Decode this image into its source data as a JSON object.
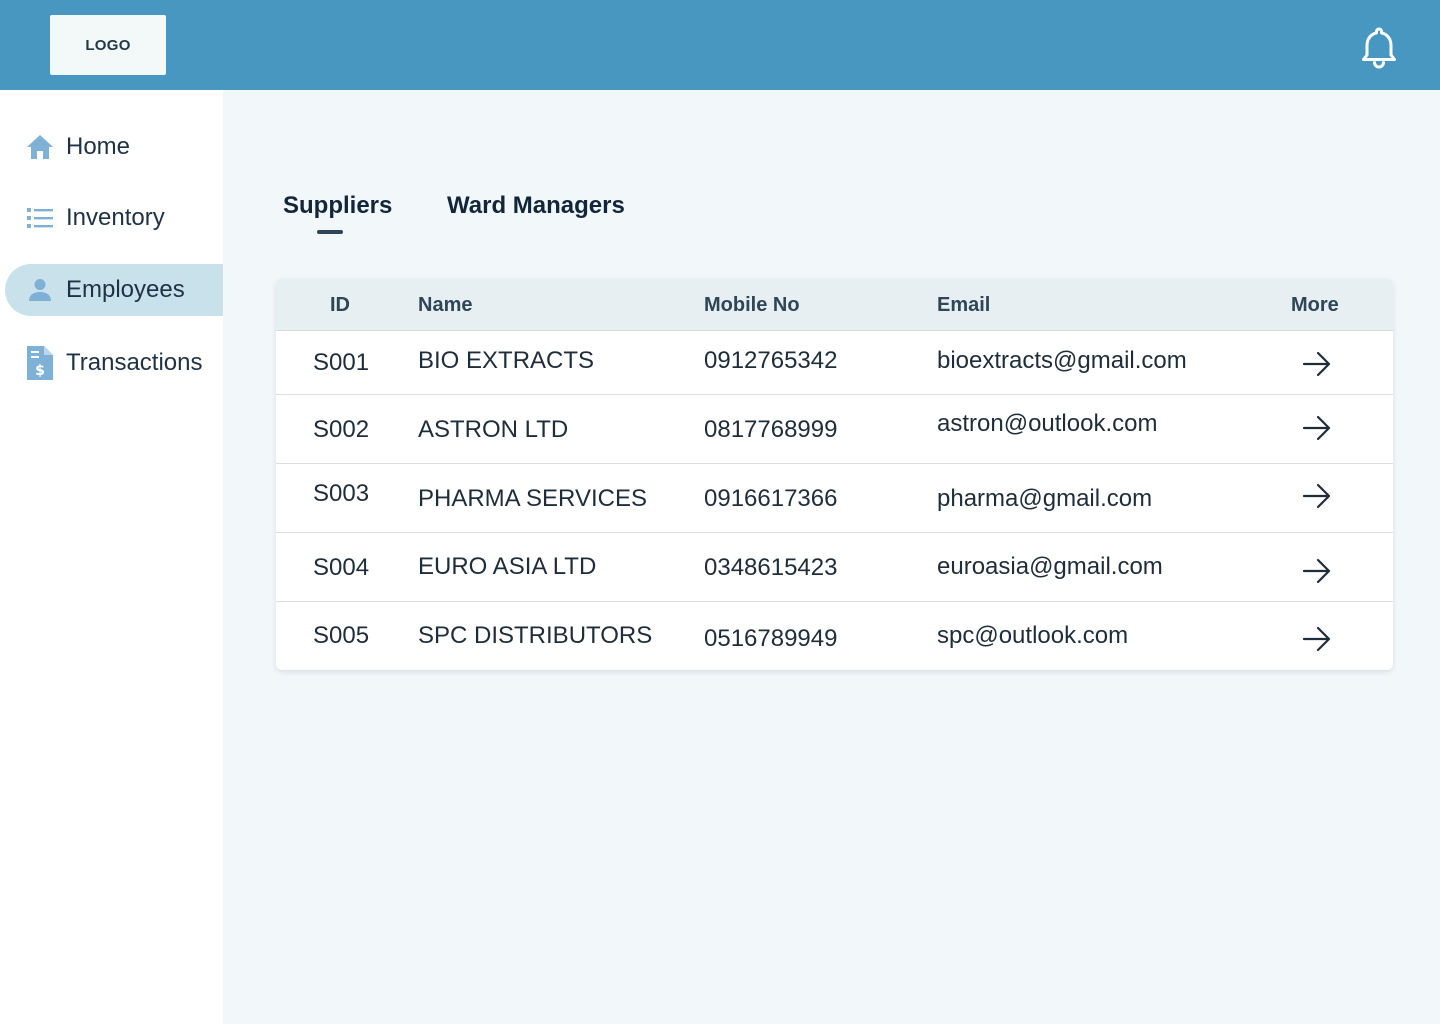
{
  "header": {
    "logo_text": "LOGO",
    "notification_icon": "bell-icon"
  },
  "sidebar": {
    "items": [
      {
        "label": "Home",
        "icon": "home-icon",
        "active": false
      },
      {
        "label": "Inventory",
        "icon": "list-icon",
        "active": false
      },
      {
        "label": "Employees",
        "icon": "person-icon",
        "active": true
      },
      {
        "label": "Transactions",
        "icon": "invoice-icon",
        "active": false
      }
    ]
  },
  "tabs": [
    {
      "label": "Suppliers",
      "active": true
    },
    {
      "label": "Ward Managers",
      "active": false
    }
  ],
  "table": {
    "columns": [
      "ID",
      "Name",
      "Mobile No",
      "Email",
      "More"
    ],
    "rows": [
      {
        "id": "S001",
        "name": "BIO EXTRACTS",
        "mobile": "0912765342",
        "email": "bioextracts@gmail.com"
      },
      {
        "id": "S002",
        "name": "ASTRON LTD",
        "mobile": "0817768999",
        "email": "astron@outlook.com"
      },
      {
        "id": "S003",
        "name": "PHARMA SERVICES",
        "mobile": "0916617366",
        "email": "pharma@gmail.com"
      },
      {
        "id": "S004",
        "name": "EURO ASIA LTD",
        "mobile": "0348615423",
        "email": "euroasia@gmail.com"
      },
      {
        "id": "S005",
        "name": "SPC DISTRIBUTORS",
        "mobile": "0516789949",
        "email": "spc@outlook.com"
      }
    ]
  },
  "colors": {
    "topbar": "#4897c0",
    "active_nav": "#c9e1ea",
    "icon_blue": "#7fb0d6",
    "background": "#f2f7fa"
  }
}
